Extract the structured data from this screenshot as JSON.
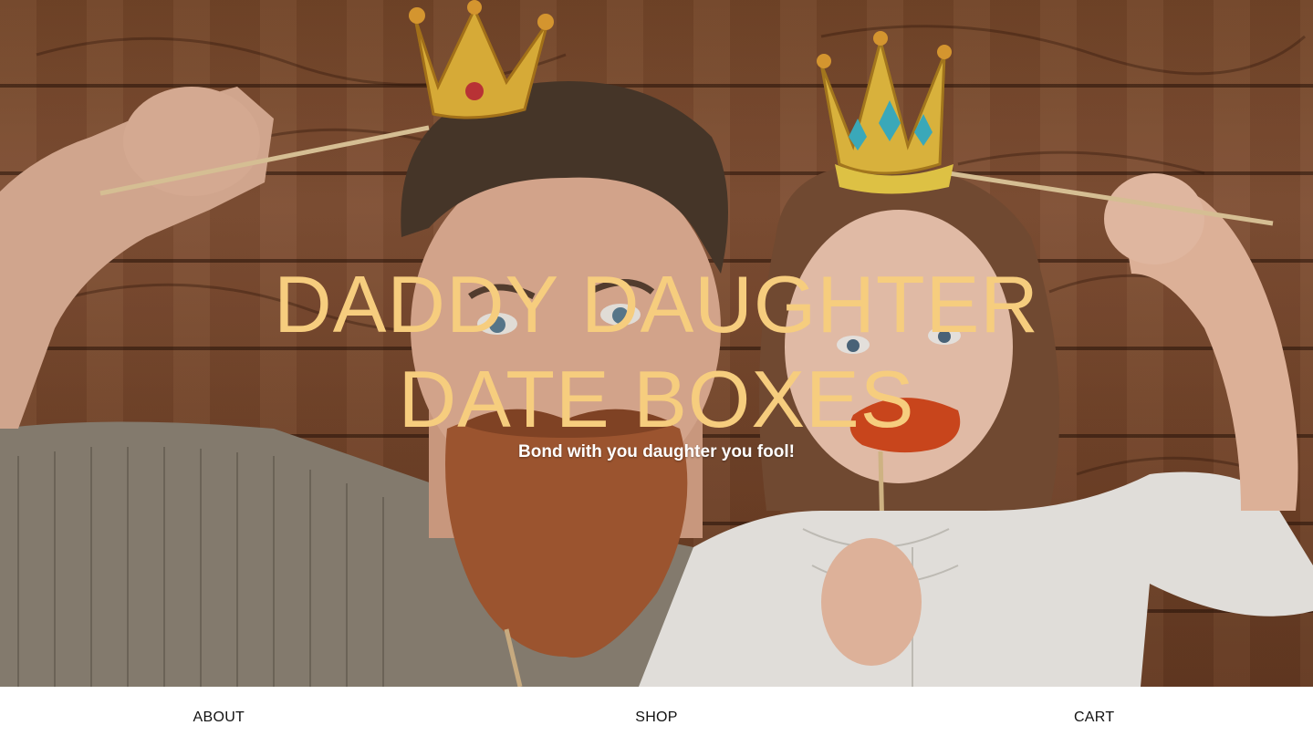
{
  "hero": {
    "title_line1": "DADDY DAUGHTER",
    "title_line2": "DATE BOXES",
    "subtitle": "Bond with you daughter you fool!",
    "image_alt": "Father with a fake beard and crown and daughter with fake lips and crown in front of a wooden wall",
    "title_color": "#f6cd7e"
  },
  "nav": {
    "items": [
      {
        "label": "ABOUT"
      },
      {
        "label": "SHOP"
      },
      {
        "label": "CART"
      }
    ]
  }
}
